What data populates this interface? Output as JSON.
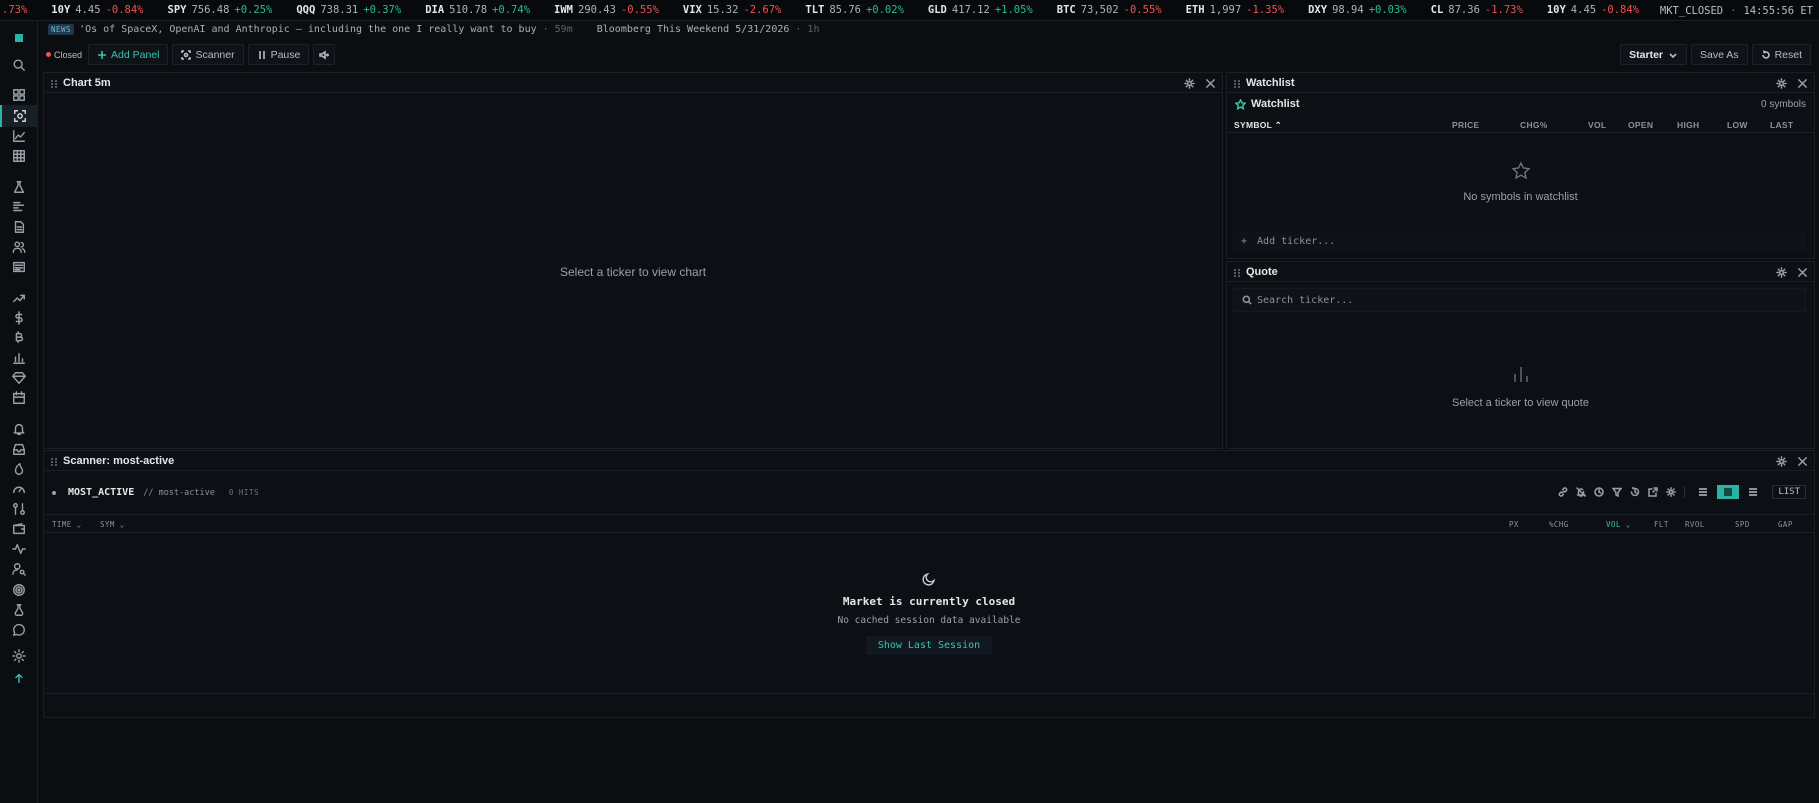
{
  "ticker": [
    {
      "sym": "",
      "px": "",
      "chg": ".73%",
      "dir": "dn"
    },
    {
      "sym": "10Y",
      "px": "4.45",
      "chg": "-0.84%",
      "dir": "dn"
    },
    {
      "sym": "SPY",
      "px": "756.48",
      "chg": "+0.25%",
      "dir": "up"
    },
    {
      "sym": "QQQ",
      "px": "738.31",
      "chg": "+0.37%",
      "dir": "up"
    },
    {
      "sym": "DIA",
      "px": "510.78",
      "chg": "+0.74%",
      "dir": "up"
    },
    {
      "sym": "IWM",
      "px": "290.43",
      "chg": "-0.55%",
      "dir": "dn"
    },
    {
      "sym": "VIX",
      "px": "15.32",
      "chg": "-2.67%",
      "dir": "dn"
    },
    {
      "sym": "TLT",
      "px": "85.76",
      "chg": "+0.02%",
      "dir": "up"
    },
    {
      "sym": "GLD",
      "px": "417.12",
      "chg": "+1.05%",
      "dir": "up"
    },
    {
      "sym": "BTC",
      "px": "73,502",
      "chg": "-0.55%",
      "dir": "dn"
    },
    {
      "sym": "ETH",
      "px": "1,997",
      "chg": "-1.35%",
      "dir": "dn"
    },
    {
      "sym": "DXY",
      "px": "98.94",
      "chg": "+0.03%",
      "dir": "up"
    },
    {
      "sym": "CL",
      "px": "87.36",
      "chg": "-1.73%",
      "dir": "dn"
    },
    {
      "sym": "10Y",
      "px": "4.45",
      "chg": "-0.84%",
      "dir": "dn"
    }
  ],
  "market": {
    "status": "MKT_CLOSED",
    "time": "14:55:56 ET"
  },
  "news": {
    "tag": "NEWS",
    "items": [
      {
        "headline": "'Os of SpaceX, OpenAI and Anthropic — including the one I really want to buy",
        "age": "· 59m"
      },
      {
        "headline": "Bloomberg This Weekend 5/31/2026",
        "age": "· 1h"
      }
    ]
  },
  "toolbar": {
    "status": "Closed",
    "add_panel": "Add Panel",
    "scanner": "Scanner",
    "pause": "Pause",
    "layout": "Starter",
    "save_as": "Save As",
    "reset": "Reset"
  },
  "chart_panel": {
    "title": "Chart 5m",
    "empty": "Select a ticker to view chart"
  },
  "watchlist": {
    "title": "Watchlist",
    "list_name": "Watchlist",
    "count": "0 symbols",
    "columns": [
      "SYMBOL",
      "PRICE",
      "CHG%",
      "VOL",
      "OPEN",
      "HIGH",
      "LOW",
      "LAST"
    ],
    "empty": "No symbols in watchlist",
    "add_placeholder": "Add ticker..."
  },
  "quote": {
    "title": "Quote",
    "search_placeholder": "Search ticker...",
    "empty": "Select a ticker to view quote"
  },
  "scanner": {
    "title": "Scanner: most-active",
    "name": "MOST_ACTIVE",
    "slug": "// most-active",
    "hits": "0 HITS",
    "list_label": "LIST",
    "columns": [
      "TIME",
      "SYM",
      "PX",
      "%CHG",
      "VOL",
      "FLT",
      "RVOL",
      "SPD",
      "GAP"
    ],
    "empty_title": "Market is currently closed",
    "empty_sub": "No cached session data available",
    "show_last": "Show Last Session"
  },
  "colors": {
    "accent": "#2bb3a3",
    "up": "#27c08a",
    "down": "#ef5350"
  }
}
